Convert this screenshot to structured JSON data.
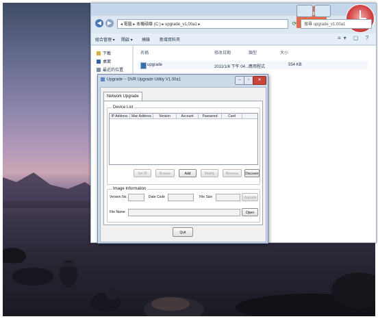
{
  "explorer": {
    "address_path": "◂ 電腦 ▸ 本機磁碟 (C:) ▸ upgrade_v1.00a1 ▸",
    "search_placeholder": "搜尋 upgrade_v1.00a1",
    "pane_label": "畫面",
    "toolbar": [
      "組合管理 ▾",
      "開啟 ▾",
      "燒錄",
      "新增資料夾"
    ],
    "nav_items": [
      "下載",
      "桌面",
      "最近的位置"
    ],
    "columns": [
      "名稱",
      "修改日期",
      "類型",
      "大小"
    ],
    "file": {
      "name": "upgrade",
      "date": "2011/1/6 下午 04...",
      "type": "應用程式",
      "size": "554 KB"
    }
  },
  "dialog": {
    "title": "Upgrade -- DVR Upgrade Utility V1.00a1",
    "tab": "Network Upgrade",
    "device_list": {
      "label": "Device List",
      "columns": [
        "IP Address",
        "Mac Address",
        "Version",
        "Account",
        "Password",
        "Card"
      ]
    },
    "buttons": {
      "set_ip": "Set IP",
      "browse": "Browse",
      "add": "Add",
      "modify": "Modify",
      "remove": "Remove",
      "discover": "Discover",
      "upgrade": "Upgrade",
      "open": "Open",
      "quit": "Quit"
    },
    "image_info": {
      "label": "Image Information",
      "version_label": "Version No.",
      "date_label": "Date Code",
      "size_label": "File Size",
      "name_label": "File Name"
    }
  }
}
